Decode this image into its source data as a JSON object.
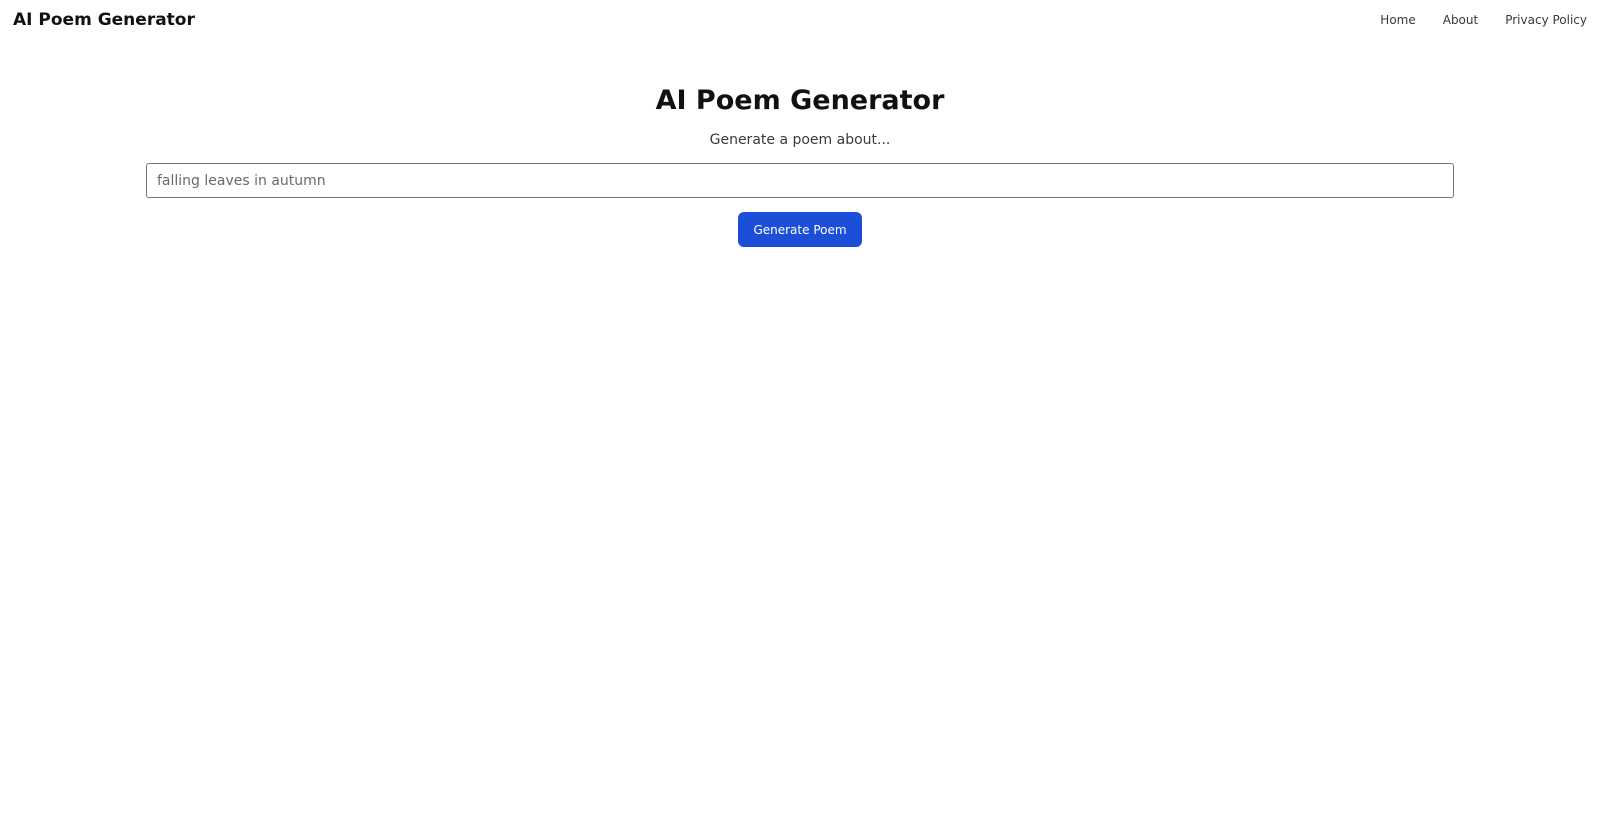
{
  "header": {
    "brand": "AI Poem Generator",
    "nav": [
      {
        "label": "Home"
      },
      {
        "label": "About"
      },
      {
        "label": "Privacy Policy"
      }
    ]
  },
  "main": {
    "title": "AI Poem Generator",
    "subtitle": "Generate a poem about...",
    "prompt_input": {
      "value": "",
      "placeholder": "falling leaves in autumn"
    },
    "generate_label": "Generate Poem"
  },
  "colors": {
    "accent": "#1d4ed8",
    "background": "#ffffff",
    "text": "#111111"
  }
}
